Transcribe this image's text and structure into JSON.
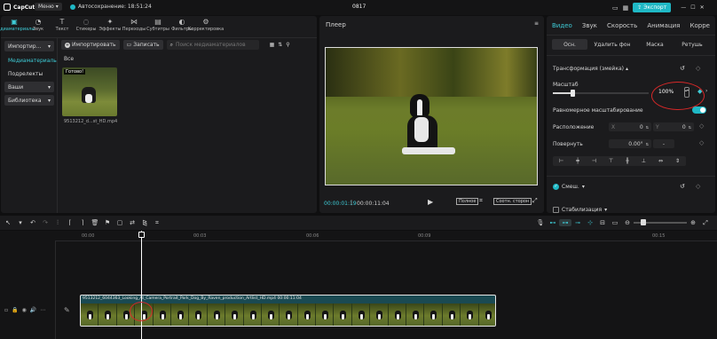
{
  "app": {
    "logo": "CapCut",
    "menu": "Меню",
    "autosave": "Автосохранение: 18:51:24",
    "project": "0817",
    "export": "Экспорт"
  },
  "toolbar": [
    {
      "label": "Медиаматериалы",
      "icon": "media-icon",
      "active": true
    },
    {
      "label": "Звук",
      "icon": "audio-icon"
    },
    {
      "label": "Текст",
      "icon": "text-icon"
    },
    {
      "label": "Стикеры",
      "icon": "sticker-icon"
    },
    {
      "label": "Эффекты",
      "icon": "effects-icon"
    },
    {
      "label": "Переходы",
      "icon": "transitions-icon"
    },
    {
      "label": "Субтитры",
      "icon": "subtitles-icon"
    },
    {
      "label": "Фильтры",
      "icon": "filters-icon"
    },
    {
      "label": "Корректировка",
      "icon": "adjust-icon"
    }
  ],
  "sidebar": {
    "items": [
      "Импортир...",
      "Медиаматериаль",
      "Подрелекты",
      "Ваши",
      "Библиотека"
    ]
  },
  "media": {
    "import": "Импортировать",
    "record": "Записать",
    "search_placeholder": "Поиск медиаматериалов",
    "filter_all": "Все",
    "clip_status": "Готово!",
    "clip_name": "9513212_d...st_HD.mp4"
  },
  "player": {
    "title": "Плеер",
    "current": "00:00:01:19",
    "total": "00:00:11:04",
    "full": "Полное",
    "ratio": "Соотн. сторон"
  },
  "inspector": {
    "tabs": [
      "Видео",
      "Звук",
      "Скорость",
      "Анимация",
      "Корре"
    ],
    "subtabs": [
      "Осн.",
      "Удалить фон",
      "Маска",
      "Ретушь"
    ],
    "transform": "Трансформация (змейка)",
    "scale_label": "Масштаб",
    "scale_value": "100%",
    "scale_level": 0.2,
    "uniform": "Равномерное масштабирование",
    "position_label": "Расположение",
    "pos_x_label": "X",
    "pos_x": "0",
    "pos_y_label": "Y",
    "pos_y": "0",
    "rotate_label": "Повернуть",
    "rotate_value": "0.00°",
    "rotate_dash": "-",
    "blend": "Смеш.",
    "stabilize": "Стабилизация"
  },
  "timeline": {
    "ticks": [
      "00:00",
      "00:03",
      "00:06",
      "00:09",
      "00:15"
    ],
    "clip_label": "9513212_6044363_Looking_At_Camera_Portrait_Park_Dog_By_Raven_production_Artlist_HD.mp4   00:00:11:04"
  },
  "colors": {
    "accent": "#1fb8c5",
    "annotation": "#d62828"
  }
}
